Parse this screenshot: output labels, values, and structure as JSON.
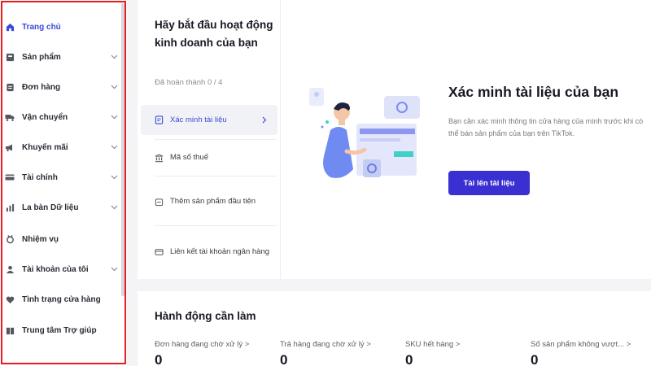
{
  "sidebar": {
    "items": [
      {
        "label": "Trang chủ",
        "icon": "home-icon",
        "expandable": false,
        "active": true
      },
      {
        "label": "Sản phẩm",
        "icon": "product-icon",
        "expandable": true
      },
      {
        "label": "Đơn hàng",
        "icon": "order-icon",
        "expandable": true
      },
      {
        "label": "Vận chuyển",
        "icon": "shipping-icon",
        "expandable": true
      },
      {
        "label": "Khuyến mãi",
        "icon": "promotion-icon",
        "expandable": true
      },
      {
        "label": "Tài chính",
        "icon": "finance-icon",
        "expandable": true
      },
      {
        "label": "La bàn Dữ liệu",
        "icon": "data-compass-icon",
        "expandable": true
      },
      {
        "label": "Nhiệm vụ",
        "icon": "task-icon",
        "expandable": false
      },
      {
        "label": "Tài khoản của tôi",
        "icon": "account-icon",
        "expandable": true
      },
      {
        "label": "Tình trạng cửa hàng",
        "icon": "shop-health-icon",
        "expandable": false
      },
      {
        "label": "Trung tâm Trợ giúp",
        "icon": "help-center-icon",
        "expandable": false
      }
    ]
  },
  "onboarding": {
    "title": "Hãy bắt đầu hoạt động kinh doanh của bạn",
    "progress": "Đã hoàn thành 0 / 4",
    "steps": [
      {
        "label": "Xác minh tài liệu",
        "icon": "document-icon",
        "active": true
      },
      {
        "label": "Mã số thuế",
        "icon": "bank-icon"
      },
      {
        "label": "Thêm sản phẩm đầu tiên",
        "icon": "box-icon"
      },
      {
        "label": "Liên kết tài khoản ngân hàng",
        "icon": "card-icon"
      }
    ],
    "hero": {
      "title": "Xác minh tài liệu của bạn",
      "description": "Bạn cần xác minh thông tin cửa hàng của mình trước khi có thể bán sản phẩm của bạn trên TikTok.",
      "button": "Tải lên tài liệu"
    }
  },
  "actions": {
    "title": "Hành động cần làm",
    "metrics": [
      {
        "label": "Đơn hàng đang chờ xử lý >",
        "value": "0"
      },
      {
        "label": "Trả hàng đang chờ xử lý >",
        "value": "0"
      },
      {
        "label": "SKU hết hàng >",
        "value": "0"
      },
      {
        "label": "Số sản phẩm không vượt... >",
        "value": "0"
      }
    ]
  },
  "colors": {
    "accent": "#3a2fd1",
    "active_nav": "#3b4bd8",
    "highlight_border": "#e81c25"
  }
}
